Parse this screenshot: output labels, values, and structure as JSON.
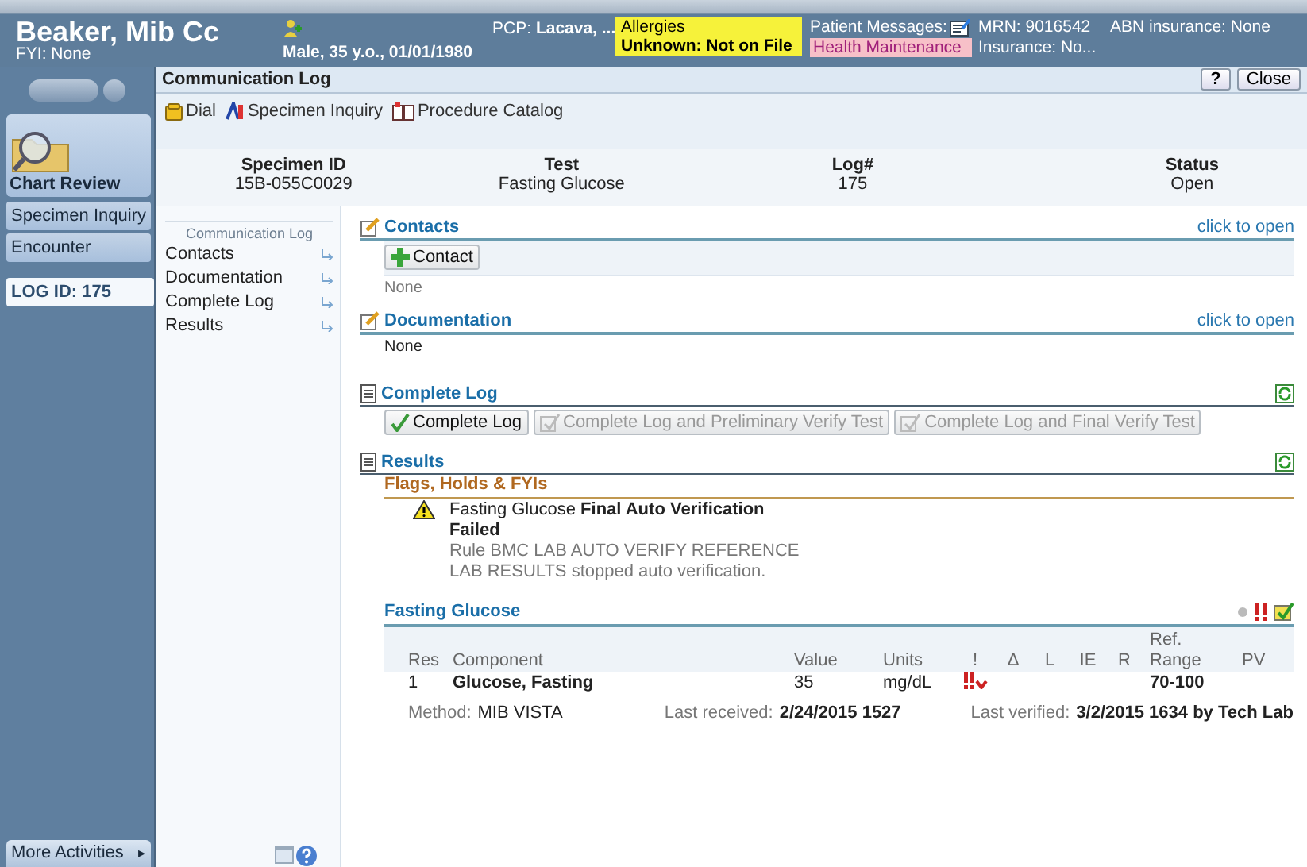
{
  "patient": {
    "name": "Beaker, Mib Cc",
    "fyi": "FYI: None",
    "demographics": "Male, 35 y.o., 01/01/1980",
    "pcp_label": "PCP:",
    "pcp": "Lacava, ...",
    "allergies_label": "Allergies",
    "allergies": "Unknown: Not on File",
    "messages": "Patient Messages:",
    "health_maintenance": "Health Maintenance",
    "mrn": "MRN: 9016542",
    "insurance": "Insurance: No...",
    "abn": "ABN insurance: None"
  },
  "sidebar": {
    "chart_review": "Chart Review",
    "items": [
      {
        "label": "Specimen Inquiry",
        "selected": false
      },
      {
        "label": "Encounter",
        "selected": false
      },
      {
        "label": "LOG ID: 175",
        "selected": true
      }
    ],
    "more_activities": "More Activities",
    "more_arrow": "▸"
  },
  "activity": {
    "title": "Communication Log",
    "help": "?",
    "close": "Close"
  },
  "toolbar": [
    "Dial",
    "Specimen Inquiry",
    "Procedure Catalog"
  ],
  "summary": [
    {
      "label": "Specimen ID",
      "value": "15B-055C0029"
    },
    {
      "label": "Test",
      "value": "Fasting Glucose"
    },
    {
      "label": "Log#",
      "value": "175"
    },
    {
      "label": "Status",
      "value": "Open"
    }
  ],
  "nav": {
    "title": "Communication Log",
    "items": [
      "Contacts",
      "Documentation",
      "Complete Log",
      "Results"
    ]
  },
  "contacts": {
    "title": "Contacts",
    "link": "click to open",
    "button": "Contact",
    "text": "None"
  },
  "documentation": {
    "title": "Documentation",
    "link": "click to open",
    "text": "None"
  },
  "complete_log": {
    "title": "Complete Log",
    "buttons": [
      {
        "label": "Complete Log",
        "disabled": false
      },
      {
        "label": "Complete Log and Preliminary Verify Test",
        "disabled": true
      },
      {
        "label": "Complete Log and Final Verify Test",
        "disabled": true
      }
    ]
  },
  "results": {
    "title": "Results",
    "flags_title": "Flags, Holds & FYIs",
    "flag_title": "Fasting Glucose **Final Auto Verification**",
    "flag_status": "Failed",
    "flag_lines": [
      "Rule BMC LAB AUTO VERIFY REFERENCE",
      "LAB RESULTS stopped auto verification."
    ],
    "test_title": "Fasting Glucose",
    "columns": [
      "Res",
      "Component",
      "Value",
      "Units",
      "!",
      "Δ",
      "L",
      "IE",
      "R",
      "Ref.\nRange",
      "PV"
    ],
    "rows": [
      {
        "res": "1",
        "component": "Glucose, Fasting",
        "value": "35",
        "units": "mg/dL",
        "abnormal": true,
        "range": "70-100"
      }
    ],
    "method_label": "Method:",
    "method": "MIB VISTA",
    "received_label": "Last received:",
    "received": "2/24/2015 1527",
    "verified_label": "Last verified:",
    "verified": "3/2/2015 1634 by Tech Lab"
  }
}
